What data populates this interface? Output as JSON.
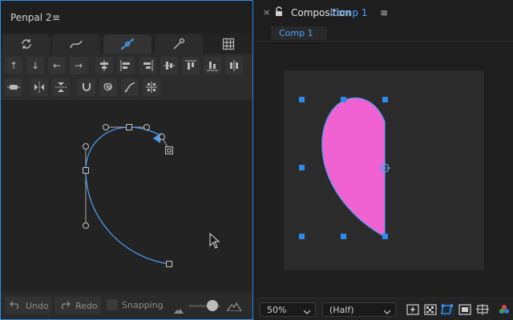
{
  "left_panel": {
    "title": "Penpal 2",
    "menu_icon": "hamburger-menu-icon",
    "tabs": [
      {
        "icon": "refresh-icon",
        "active": false
      },
      {
        "icon": "curve-path-icon",
        "active": false
      },
      {
        "icon": "bezier-pen-icon",
        "active": true
      },
      {
        "icon": "single-point-icon",
        "active": false
      },
      {
        "icon": "grid-icon",
        "active": false
      }
    ],
    "tool_rows": [
      [
        "arrow-up-icon",
        "arrow-down-icon",
        "arrow-left-icon",
        "arrow-right-icon",
        "align-top-center-icon",
        "align-left-icon",
        "align-right-icon",
        "align-center-horizontal-icon",
        "align-top-icon",
        "align-bottom-icon",
        "align-center-vertical-icon"
      ],
      [
        "distribute-horizontal-icon",
        "flip-horizontal-icon",
        "flip-vertical-icon",
        "magnet-icon",
        "spiral-icon",
        "curve-tool-icon",
        "crosshair-grid-icon"
      ]
    ],
    "footer": {
      "undo_label": "Undo",
      "redo_label": "Redo",
      "snapping_label": "Snapping",
      "snapping_checked": false,
      "zoom_min_icon": "mountain-small-icon",
      "zoom_max_icon": "mountain-large-icon"
    }
  },
  "right_panel": {
    "title_prefix": "Composition",
    "comp_name": "Comp 1",
    "close_icon": "close-icon",
    "lock_icon": "lock-icon",
    "menu_icon": "hamburger-menu-icon",
    "active_tab": "Comp 1",
    "shape_fill": "#f062d2",
    "handle_color": "#2d8ceb",
    "bottom_bar": {
      "zoom_value": "50%",
      "resolution_value": "(Half)",
      "view_icons": [
        "fast-preview-icon",
        "transparency-grid-icon",
        "mask-path-icon",
        "region-of-interest-icon",
        "toggle-guides-icon",
        "color-wheel-icon"
      ]
    }
  },
  "colors": {
    "accent": "#2d8ceb",
    "panel_bg": "#232323",
    "text": "#c8c8c8"
  }
}
